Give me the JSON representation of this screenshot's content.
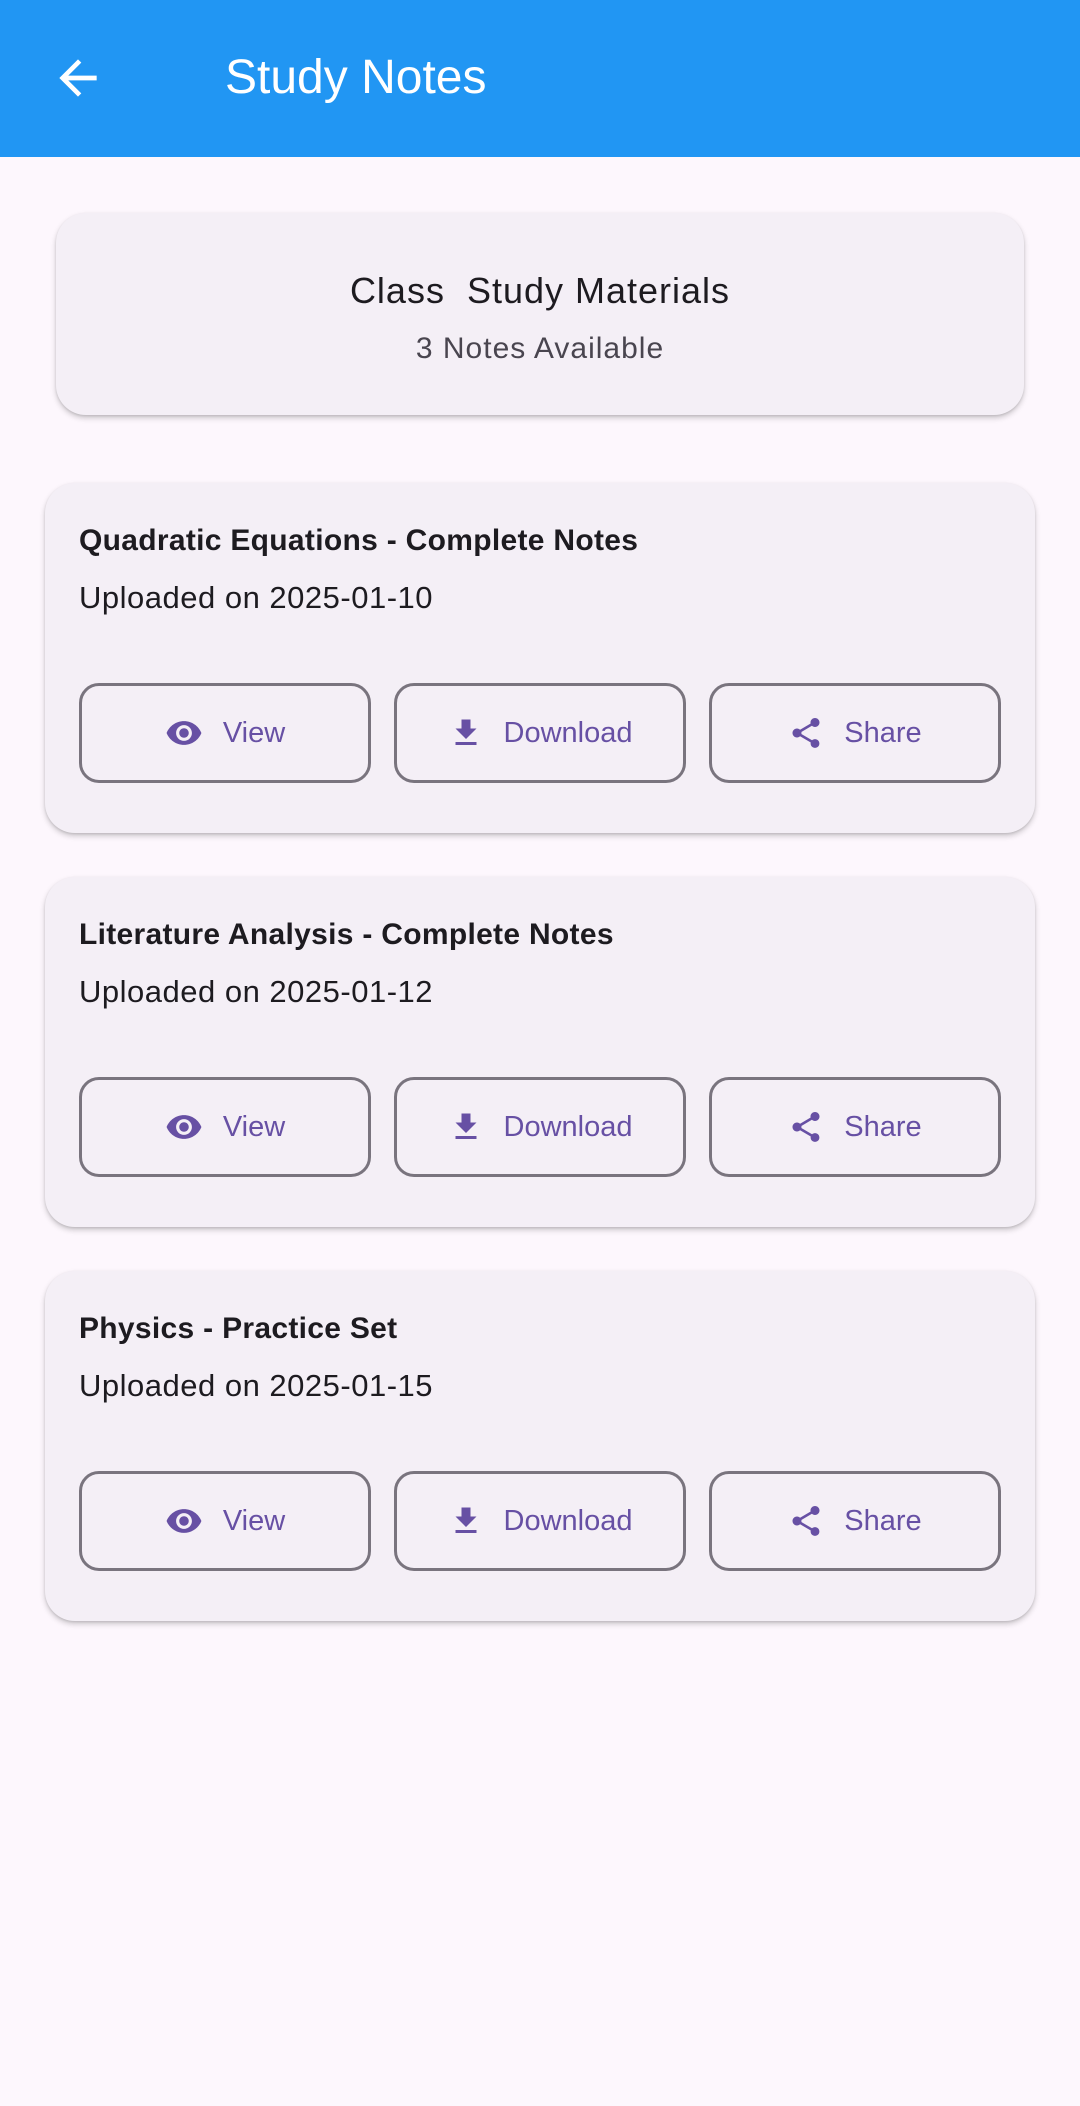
{
  "appbar": {
    "title": "Study Notes",
    "back_icon": "arrow-back-icon",
    "background": "#2196f3"
  },
  "header": {
    "title": "Class  Study Materials",
    "count_text": "3 Notes Available"
  },
  "colors": {
    "accent": "#6750a4",
    "card": "#f4eff6",
    "page": "#fdf7fd",
    "outline": "#79747e"
  },
  "actions": {
    "view": {
      "label": "View",
      "icon": "eye-icon"
    },
    "download": {
      "label": "Download",
      "icon": "download-icon"
    },
    "share": {
      "label": "Share",
      "icon": "share-icon"
    }
  },
  "notes": [
    {
      "title": "Quadratic Equations - Complete Notes",
      "date": "Uploaded on 2025-01-10"
    },
    {
      "title": "Literature Analysis - Complete Notes",
      "date": "Uploaded on 2025-01-12"
    },
    {
      "title": "Physics - Practice Set",
      "date": "Uploaded on 2025-01-15"
    }
  ]
}
